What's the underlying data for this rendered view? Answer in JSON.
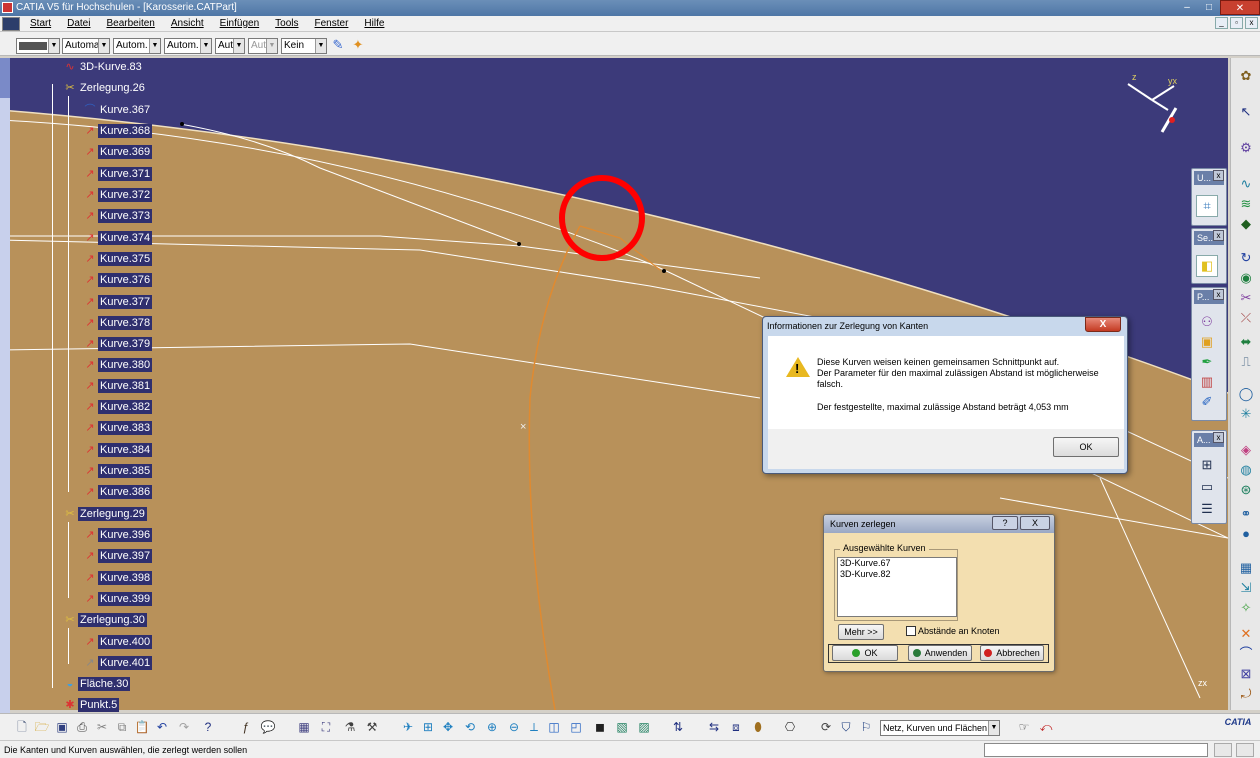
{
  "window": {
    "title": "CATIA V5 für Hochschulen - [Karosserie.CATPart]",
    "controls": [
      "–",
      "□",
      "✕"
    ]
  },
  "menu": {
    "items": [
      "Start",
      "Datei",
      "Bearbeiten",
      "Ansicht",
      "Einfügen",
      "Tools",
      "Fenster",
      "Hilfe"
    ],
    "mdi_controls": [
      "_",
      "▫",
      "x"
    ]
  },
  "properties_toolbar": {
    "line_type": "Automa",
    "thickness": "Autom.",
    "linetype2": "Autom.",
    "layer_short": "Aut",
    "layer_short_disabled": "Aut",
    "layer": "Kein"
  },
  "tree": {
    "nodes": [
      {
        "label": "3D-Kurve.83",
        "kind": "curve"
      },
      {
        "label": "Zerlegung.26",
        "kind": "zerlegung"
      },
      {
        "label": "Kurve.367",
        "kind": "curve-plain"
      },
      {
        "label": "Kurve.368",
        "kind": "curve"
      },
      {
        "label": "Kurve.369",
        "kind": "curve"
      },
      {
        "label": "Kurve.371",
        "kind": "curve"
      },
      {
        "label": "Kurve.372",
        "kind": "curve"
      },
      {
        "label": "Kurve.373",
        "kind": "curve"
      },
      {
        "label": "Kurve.374",
        "kind": "curve"
      },
      {
        "label": "Kurve.375",
        "kind": "curve"
      },
      {
        "label": "Kurve.376",
        "kind": "curve"
      },
      {
        "label": "Kurve.377",
        "kind": "curve"
      },
      {
        "label": "Kurve.378",
        "kind": "curve"
      },
      {
        "label": "Kurve.379",
        "kind": "curve"
      },
      {
        "label": "Kurve.380",
        "kind": "curve"
      },
      {
        "label": "Kurve.381",
        "kind": "curve"
      },
      {
        "label": "Kurve.382",
        "kind": "curve"
      },
      {
        "label": "Kurve.383",
        "kind": "curve"
      },
      {
        "label": "Kurve.384",
        "kind": "curve"
      },
      {
        "label": "Kurve.385",
        "kind": "curve"
      },
      {
        "label": "Kurve.386",
        "kind": "curve"
      },
      {
        "label": "Zerlegung.29",
        "kind": "zerlegung"
      },
      {
        "label": "Kurve.396",
        "kind": "curve"
      },
      {
        "label": "Kurve.397",
        "kind": "curve"
      },
      {
        "label": "Kurve.398",
        "kind": "curve"
      },
      {
        "label": "Kurve.399",
        "kind": "curve"
      },
      {
        "label": "Zerlegung.30",
        "kind": "zerlegung"
      },
      {
        "label": "Kurve.400",
        "kind": "curve"
      },
      {
        "label": "Kurve.401",
        "kind": "curve"
      },
      {
        "label": "Fläche.30",
        "kind": "surface"
      },
      {
        "label": "Punkt.5",
        "kind": "point"
      }
    ]
  },
  "compass": {
    "z": "z",
    "x": "yx"
  },
  "small_axis": {
    "label": "zx"
  },
  "floating_panels": [
    {
      "title": "U...",
      "close": "x"
    },
    {
      "title": "Se...",
      "close": "x"
    },
    {
      "title": "P...",
      "close": "x"
    },
    {
      "title": "A...",
      "close": "x"
    }
  ],
  "error_dialog": {
    "title": "Informationen zur Zerlegung von Kanten",
    "close": "X",
    "warning_icon": "warning-icon",
    "warning_mark": "!",
    "line1": "Diese Kurven weisen keinen gemeinsamen Schnittpunkt auf.",
    "line2": "Der Parameter für den maximal zulässigen Abstand ist möglicherweise falsch.",
    "line3": "Der festgestellte, maximal zulässige Abstand beträgt 4,053 mm",
    "ok": "OK"
  },
  "split_dialog": {
    "title": "Kurven zerlegen",
    "help": "?",
    "close": "X",
    "group_label": "Ausgewählte Kurven",
    "selected": [
      "3D-Kurve.67",
      "3D-Kurve.82"
    ],
    "more": "Mehr >>",
    "checkbox_label": "Abstände an Knoten",
    "checkbox_checked": false,
    "ok": "OK",
    "apply": "Anwenden",
    "cancel": "Abbrechen",
    "colors": {
      "ok": "#2aa02a",
      "apply": "#2a7a3a",
      "cancel": "#d02020"
    }
  },
  "bottom_toolbar": {
    "filter": "Netz, Kurven und Flächen",
    "logo": "CATIA"
  },
  "status": {
    "text": "Die Kanten und Kurven auswählen, die zerlegt werden sollen"
  },
  "colors": {
    "background": "#3c3a7a",
    "surface": "#b8915a",
    "highlight_circle": "#ff0000",
    "curve_orange": "#e08a30"
  }
}
